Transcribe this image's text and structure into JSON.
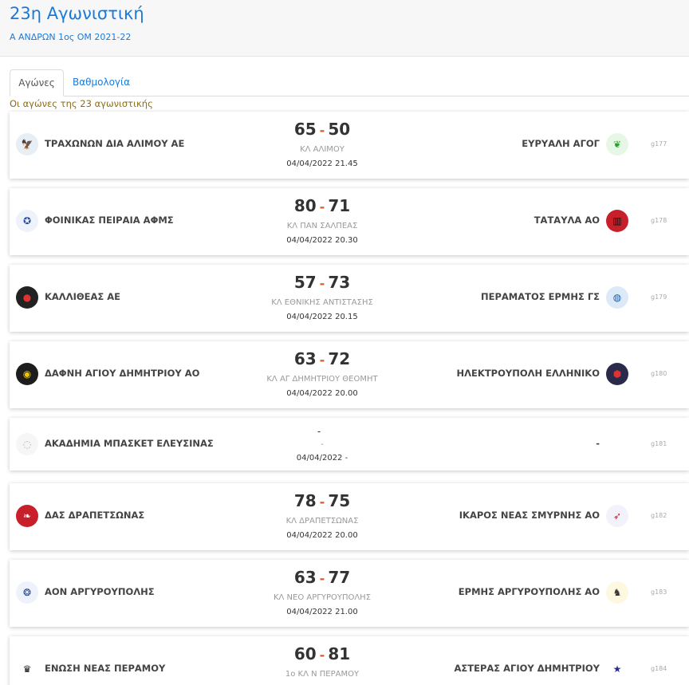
{
  "header": {
    "title": "23η Αγωνιστική",
    "subtitle": "Α ΑΝΔΡΩΝ 1ος ΟΜ 2021-22"
  },
  "tabs": [
    {
      "label": "Αγώνες"
    },
    {
      "label": "Βαθμολογία"
    }
  ],
  "caption": "Οι αγώνες της 23 αγωνιστικής",
  "matches": [
    {
      "home": "ΤΡΑΧΩΝΩΝ ΔΙΑ ΑΛΙΜΟΥ ΑΕ",
      "home_score": "65",
      "sep": "-",
      "away_score": "50",
      "away": "ΕΥΡΥΑΛΗ ΑΓΟΓ",
      "venue": "ΚΛ ΑΛΙΜΟΥ",
      "datetime": "04/04/2022 21.45",
      "code": "g177",
      "home_icon": "eagle-logo",
      "away_icon": "leaf-logo"
    },
    {
      "home": "ΦΟΙΝΙΚΑΣ ΠΕΙΡΑΙΑ ΑΦΜΣ",
      "home_score": "80",
      "sep": "-",
      "away_score": "71",
      "away": "ΤΑΤΑΥΛΑ ΑΟ",
      "venue": "ΚΛ ΠΑΝ ΣΑΛΠΕΑΣ",
      "datetime": "04/04/2022 20.30",
      "code": "g178",
      "home_icon": "crest-logo",
      "away_icon": "striped-shield-logo"
    },
    {
      "home": "ΚΑΛΛΙΘΕΑΣ ΑΕ",
      "home_score": "57",
      "sep": "-",
      "away_score": "73",
      "away": "ΠΕΡΑΜΑΤΟΣ ΕΡΜΗΣ ΓΣ",
      "venue": "ΚΛ ΕΘΝΙΚΗΣ ΑΝΤΙΣΤΑΣΗΣ",
      "datetime": "04/04/2022 20.15",
      "code": "g179",
      "home_icon": "ball-logo",
      "away_icon": "globe-logo"
    },
    {
      "home": "ΔΑΦΝΗ ΑΓΙΟΥ ΔΗΜΗΤΡΙΟΥ ΑΟ",
      "home_score": "63",
      "sep": "-",
      "away_score": "72",
      "away": "ΗΛΕΚΤΡΟΥΠΟΛΗ ΕΛΛΗΝΙΚΟ",
      "venue": "ΚΛ ΑΓ ΔΗΜΗΤΡΙΟΥ ΘΕΟΜΗΤ",
      "datetime": "04/04/2022 20.00",
      "code": "g180",
      "home_icon": "laurel-logo",
      "away_icon": "shield-logo"
    },
    {
      "home": "ΑΚΑΔΗΜΙΑ ΜΠΑΣΚΕΤ ΕΛΕΥΣΙΝΑΣ",
      "home_score": "-",
      "sep": "",
      "away_score": "",
      "away": "-",
      "venue": "-",
      "datetime": "04/04/2022 -",
      "code": "g181",
      "home_icon": "basketball-logo",
      "away_icon": ""
    },
    {
      "home": "ΔΑΣ ΔΡΑΠΕΤΣΩΝΑΣ",
      "home_score": "78",
      "sep": "-",
      "away_score": "75",
      "away": "ΙΚΑΡΟΣ ΝΕΑΣ ΣΜΥΡΝΗΣ ΑΟ",
      "venue": "ΚΛ ΔΡΑΠΕΤΣΩΝΑΣ",
      "datetime": "04/04/2022 20.00",
      "code": "g182",
      "home_icon": "flame-logo",
      "away_icon": "wing-logo"
    },
    {
      "home": "ΑΟΝ ΑΡΓΥΡΟΥΠΟΛΗΣ",
      "home_score": "63",
      "sep": "-",
      "away_score": "77",
      "away": "ΕΡΜΗΣ ΑΡΓΥΡΟΥΠΟΛΗΣ ΑΟ",
      "venue": "ΚΛ ΝΕΟ ΑΡΓΥΡΟΥΠΟΛΗΣ",
      "datetime": "04/04/2022 21.00",
      "code": "g183",
      "home_icon": "wreath-logo",
      "away_icon": "hermes-logo"
    },
    {
      "home": "ΕΝΩΣΗ ΝΕΑΣ ΠΕΡΑΜΟΥ",
      "home_score": "60",
      "sep": "-",
      "away_score": "81",
      "away": "ΑΣΤΕΡΑΣ ΑΓΙΟΥ ΔΗΜΗΤΡΙΟΥ",
      "venue": "1ο ΚΛ Ν ΠΕΡΑΜΟΥ",
      "datetime": "",
      "code": "g184",
      "home_icon": "double-eagle-logo",
      "away_icon": "star-logo"
    }
  ]
}
